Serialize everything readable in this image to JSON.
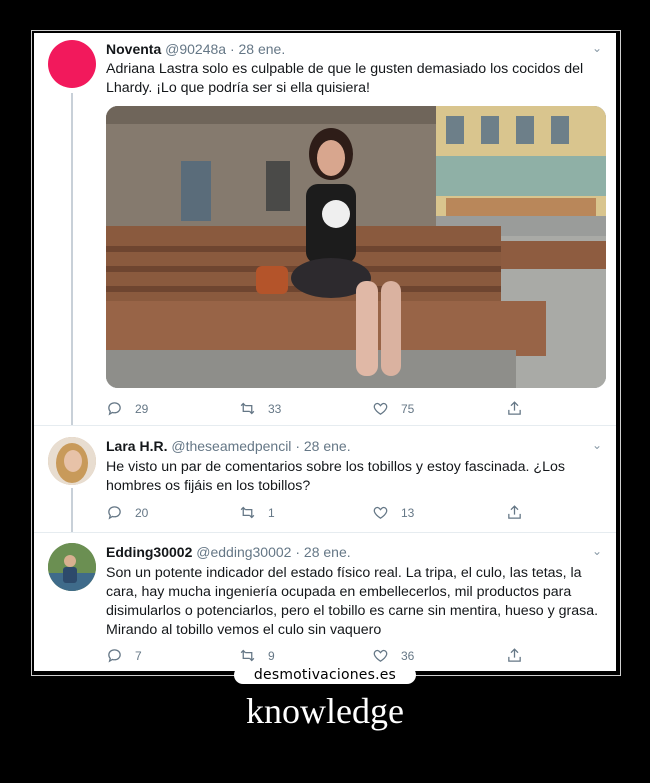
{
  "tweets": [
    {
      "name": "Noventa",
      "handle": "@90248a",
      "dot": "·",
      "date": "28 ene.",
      "text": "Adriana Lastra solo es culpable de que le gusten demasiado los cocidos del Lhardy. ¡Lo que podría ser si ella quisiera!",
      "replies": "29",
      "retweets": "33",
      "likes": "75",
      "avatar_color": "#f2195c"
    },
    {
      "name": "Lara H.R.",
      "handle": "@theseamedpencil",
      "dot": "·",
      "date": "28 ene.",
      "text": "He visto un par de comentarios sobre los tobillos y estoy fascinada. ¿Los hombres os fijáis en los tobillos?",
      "replies": "20",
      "retweets": "1",
      "likes": "13"
    },
    {
      "name": "Edding30002",
      "handle": "@edding30002",
      "dot": "·",
      "date": "28 ene.",
      "text": "Son un potente indicador del estado físico real. La tripa, el culo, las tetas, la cara, hay mucha ingeniería ocupada en embellecerlos, mil productos para disimularlos o potenciarlos, pero el tobillo es carne sin mentira, hueso y grasa. Mirando al tobillo vemos el culo sin vaquero",
      "replies": "7",
      "retweets": "9",
      "likes": "36"
    }
  ],
  "site_logo": "desmotivaciones.es",
  "caption": "knowledge",
  "icons": {
    "reply": "reply-icon",
    "retweet": "retweet-icon",
    "like": "heart-icon",
    "share": "share-icon",
    "menu": "chevron-down-icon"
  }
}
